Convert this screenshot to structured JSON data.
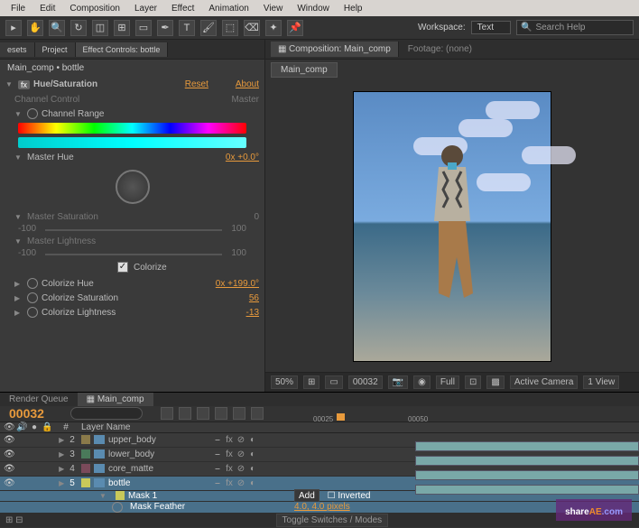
{
  "menu": [
    "File",
    "Edit",
    "Composition",
    "Layer",
    "Effect",
    "Animation",
    "View",
    "Window",
    "Help"
  ],
  "workspace": {
    "label": "Workspace:",
    "value": "Text"
  },
  "search": {
    "placeholder": "Search Help",
    "icon": "🔍"
  },
  "leftPanel": {
    "tabs": [
      "esets",
      "Project",
      "Effect Controls: bottle"
    ],
    "breadcrumb": "Main_comp • bottle",
    "effectName": "Hue/Saturation",
    "reset": "Reset",
    "about": "About",
    "channelControl": {
      "label": "Channel Control",
      "value": "Master"
    },
    "channelRange": "Channel Range",
    "masterHue": {
      "label": "Master Hue",
      "value": "0x +0.0°"
    },
    "masterSat": {
      "label": "Master Saturation",
      "value": "0",
      "min": "-100",
      "max": "100"
    },
    "masterLight": {
      "label": "Master Lightness",
      "min": "-100",
      "max": "100"
    },
    "colorize": "Colorize",
    "colorizeHue": {
      "label": "Colorize Hue",
      "value": "0x +199.0°"
    },
    "colorizeSat": {
      "label": "Colorize Saturation",
      "value": "56"
    },
    "colorizeLight": {
      "label": "Colorize Lightness",
      "value": "-13"
    }
  },
  "composition": {
    "headerLabel": "Composition: Main_comp",
    "footage": "Footage: (none)",
    "tab": "Main_comp"
  },
  "viewer": {
    "zoom": "50%",
    "time": "00032",
    "resolution": "Full",
    "camera": "Active Camera",
    "views": "1 View"
  },
  "timeline": {
    "tabs": [
      "Render Queue",
      "Main_comp"
    ],
    "timecode": "00032",
    "ruler": [
      "00025",
      "00050"
    ],
    "colHeaders": {
      "num": "#",
      "name": "Layer Name"
    },
    "layers": [
      {
        "num": "2",
        "name": "upper_body",
        "color": "#8a7a4a"
      },
      {
        "num": "3",
        "name": "lower_body",
        "color": "#4a7a5a"
      },
      {
        "num": "4",
        "name": "core_matte",
        "color": "#7a4a5a"
      },
      {
        "num": "5",
        "name": "bottle",
        "color": "#c9c95a",
        "selected": true
      }
    ],
    "mask": {
      "name": "Mask 1",
      "mode": "Add",
      "inverted": "Inverted"
    },
    "maskFeather": {
      "label": "Mask Feather",
      "value": "4.0, 4.0 pixels"
    },
    "toggleLabel": "Toggle Switches / Modes"
  },
  "watermark": {
    "a": "share",
    "b": "AE",
    "c": ".com"
  }
}
